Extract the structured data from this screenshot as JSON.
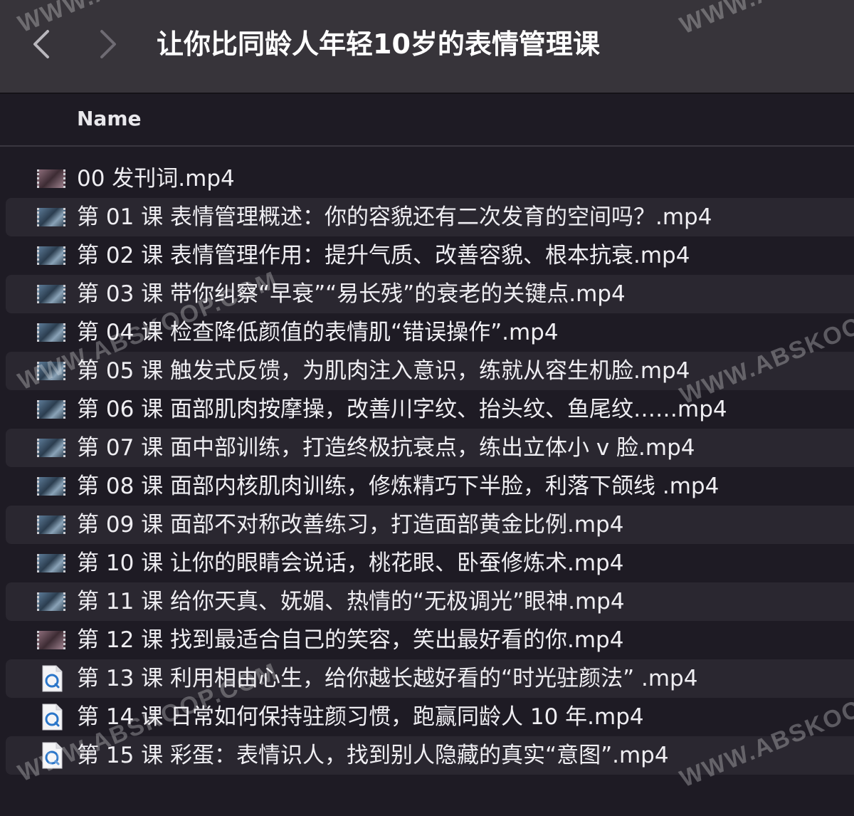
{
  "window": {
    "title": "让你比同龄人年轻10岁的表情管理课"
  },
  "navigation": {
    "back_icon": "chevron-left-icon",
    "forward_icon": "chevron-right-icon"
  },
  "list_header": {
    "name_label": "Name"
  },
  "files": [
    {
      "name": "00 发刊词.mp4",
      "icon": "video-thumbnail-icon"
    },
    {
      "name": "第 01 课 表情管理概述：你的容貌还有二次发育的空间吗？.mp4",
      "icon": "video-thumbnail-icon"
    },
    {
      "name": "第 02 课 表情管理作用：提升气质、改善容貌、根本抗衰.mp4",
      "icon": "video-thumbnail-icon"
    },
    {
      "name": "第 03 课 带你纠察“早衰”“易长残”的衰老的关键点.mp4",
      "icon": "video-thumbnail-icon"
    },
    {
      "name": "第 04 课 检查降低颜值的表情肌“错误操作”.mp4",
      "icon": "video-thumbnail-icon"
    },
    {
      "name": "第 05 课 触发式反馈，为肌肉注入意识，练就从容生机脸.mp4",
      "icon": "video-thumbnail-icon"
    },
    {
      "name": "第 06 课 面部肌肉按摩操，改善川字纹、抬头纹、鱼尾纹……mp4",
      "icon": "video-thumbnail-icon"
    },
    {
      "name": "第 07 课 面中部训练，打造终极抗衰点，练出立体小 v 脸.mp4",
      "icon": "video-thumbnail-icon"
    },
    {
      "name": "第 08 课 面部内核肌肉训练，修炼精巧下半脸，利落下颌线 .mp4",
      "icon": "video-thumbnail-icon"
    },
    {
      "name": "第 09 课 面部不对称改善练习，打造面部黄金比例.mp4",
      "icon": "video-thumbnail-icon"
    },
    {
      "name": "第 10 课 让你的眼睛会说话，桃花眼、卧蚕修炼术.mp4",
      "icon": "video-thumbnail-icon"
    },
    {
      "name": "第 11 课 给你天真、妩媚、热情的“无极调光”眼神.mp4",
      "icon": "video-thumbnail-icon"
    },
    {
      "name": "第 12 课 找到最适合自己的笑容，笑出最好看的你.mp4",
      "icon": "video-thumbnail-icon"
    },
    {
      "name": "第 13 课 利用相由心生，给你越长越好看的“时光驻颜法” .mp4",
      "icon": "quicktime-file-icon"
    },
    {
      "name": "第 14 课 日常如何保持驻颜习惯，跑赢同龄人 10 年.mp4",
      "icon": "quicktime-file-icon"
    },
    {
      "name": "第 15 课 彩蛋：表情识人，找到别人隐藏的真实“意图”.mp4",
      "icon": "quicktime-file-icon"
    }
  ],
  "watermarks": {
    "text_1": "WWW.ABSKOOP.COM",
    "text_2": "WWW.ABSKOOP.COM",
    "text_3": "WWW.ABSKOOP.COM",
    "text_4": "WWW.ABSKOOP.COM",
    "text_5": "WWW.ABSKOOP.COM",
    "text_6": "WWW.ABSKOOP.COM"
  }
}
